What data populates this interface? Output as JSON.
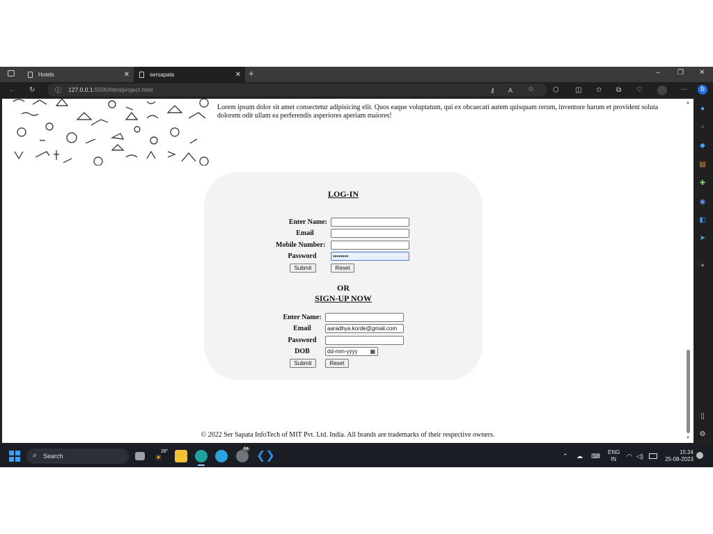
{
  "browser": {
    "tabs": [
      {
        "title": "Hotels",
        "active": false
      },
      {
        "title": "sersapata",
        "active": true
      }
    ],
    "url_host": "127.0.0.1",
    "url_rest": ":5500/html/project.html"
  },
  "page": {
    "lorem": "Lorem ipsum dolor sit amet consectetur adipisicing elit. Quos eaque voluptatum, qui ex obcaecati autem quisquam rerum, inventore harum et provident soluta dolorem odit ullam ea perferendis asperiores aperiam maiores!",
    "login": {
      "heading": "LOG-IN",
      "name_label": "Enter Name:",
      "email_label": "Email",
      "mobile_label": "Mobile Number:",
      "password_label": "Password",
      "password_value": "••••••••",
      "submit": "Submit",
      "reset": "Reset"
    },
    "or": "OR",
    "signup": {
      "heading": "SIGN-UP NOW",
      "name_label": "Enter Name:",
      "email_label": "Email",
      "email_value": "aaradhya.korde@gmail.com",
      "password_label": "Password",
      "dob_label": "DOB",
      "dob_placeholder": "dd-mm-yyyy",
      "submit": "Submit",
      "reset": "Reset"
    },
    "footer": "© 2022 Ser Sapata InfoTech of MIT Pvt. Ltd. India. All brands are trademarks of their respective owners."
  },
  "taskbar": {
    "search": "Search",
    "weather_temp": "28°",
    "whatsapp_badge": "84",
    "lang_line1": "ENG",
    "lang_line2": "IN",
    "time": "15:24",
    "date": "25-08-2023"
  },
  "colors": {
    "card_bg": "#f3f3f3",
    "browser_dark": "#202020",
    "taskbar": "#1b1d24"
  }
}
